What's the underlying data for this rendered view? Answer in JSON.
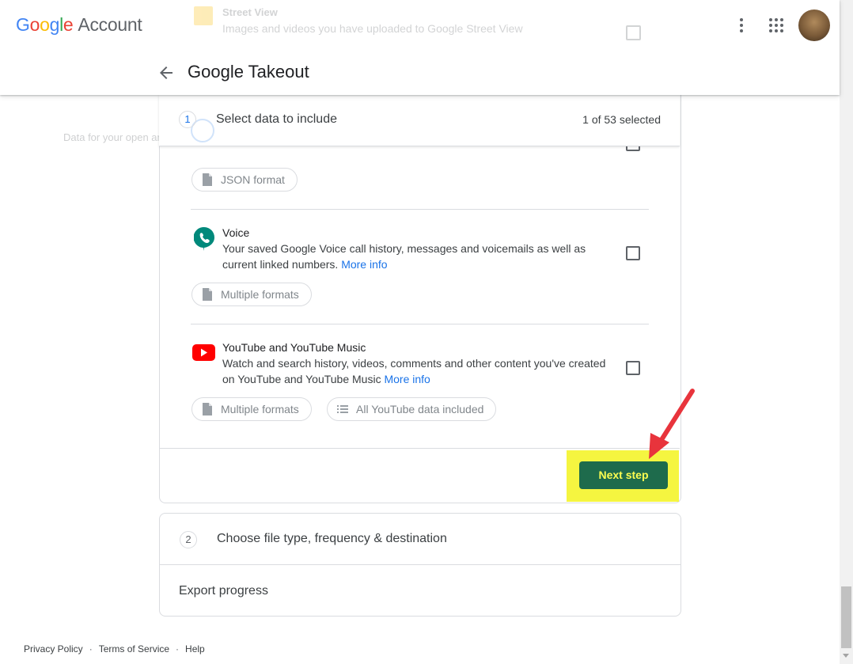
{
  "header": {
    "brand_letters": [
      {
        "ch": "G",
        "color": "#4285F4"
      },
      {
        "ch": "o",
        "color": "#EA4335"
      },
      {
        "ch": "o",
        "color": "#FBBC05"
      },
      {
        "ch": "g",
        "color": "#4285F4"
      },
      {
        "ch": "l",
        "color": "#34A853"
      },
      {
        "ch": "e",
        "color": "#EA4335"
      }
    ],
    "product": "Account",
    "page_title": "Google Takeout",
    "icons": [
      "more-vert-icon",
      "apps-grid-icon",
      "avatar"
    ]
  },
  "behind_header": {
    "title": "Street View",
    "description": "Images and videos you have uploaded to Google Street View"
  },
  "step1": {
    "number": "1",
    "label": "Select data to include",
    "count": "1 of 53 selected",
    "partial_description": "Data for your open and completed tasks. More info"
  },
  "products": [
    {
      "format_chip": "JSON format"
    },
    {
      "title": "Voice",
      "description": "Your saved Google Voice call history, messages and voicemails as well as current linked numbers.",
      "more_info": "More info",
      "format_chip": "Multiple formats",
      "icon": "google-voice-icon"
    },
    {
      "title": "YouTube and YouTube Music",
      "description": "Watch and search history, videos, comments and other content you've created on YouTube and YouTube Music",
      "more_info": "More info",
      "format_chip": "Multiple formats",
      "extra_chip": "All YouTube data included",
      "icon": "youtube-icon"
    }
  ],
  "next_button": "Next step",
  "step2": {
    "number": "2",
    "label": "Choose file type, frequency & destination",
    "export_progress": "Export progress"
  },
  "footer": {
    "links": [
      "Privacy Policy",
      "Terms of Service",
      "Help"
    ],
    "separator": "·"
  },
  "colors": {
    "accent_blue": "#1a73e8",
    "next_button_bg": "#1e6b4c",
    "next_button_text": "#fdfd50",
    "highlight": "#f5f540",
    "annotation_arrow": "#e8343c"
  }
}
